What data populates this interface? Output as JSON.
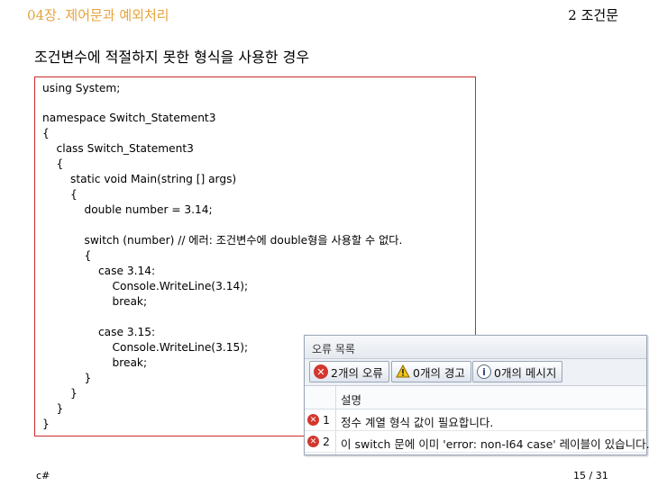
{
  "header": {
    "chapter_title": "04장. 제어문과 예외처리",
    "section_label": "2 조건문"
  },
  "slide_heading": "조건변수에 적절하지 못한 형식을 사용한 경우",
  "code": {
    "lines": [
      "using System;",
      "",
      "namespace Switch_Statement3",
      "{",
      "    class Switch_Statement3",
      "    {",
      "        static void Main(string [] args)",
      "        {",
      "            double number = 3.14;",
      "",
      "            switch (number) // 에러: 조건변수에 double형을 사용할 수 없다.",
      "            {",
      "                case 3.14:",
      "                    Console.WriteLine(3.14);",
      "                    break;",
      "",
      "                case 3.15:",
      "                    Console.WriteLine(3.15);",
      "                    break;",
      "            }",
      "        }",
      "    }",
      "}"
    ]
  },
  "error_list": {
    "title": "오류 목록",
    "filters": {
      "errors": "2개의 오류",
      "warnings": "0개의 경고",
      "messages": "0개의 메시지"
    },
    "columns": {
      "description": "설명"
    },
    "rows": [
      {
        "num": "1",
        "description": "정수 계열 형식 값이 필요합니다."
      },
      {
        "num": "2",
        "description": "이 switch 문에 이미 'error: non-I64 case' 레이블이 있습니다."
      }
    ]
  },
  "footer": {
    "left": "c#",
    "page": "15 / 31"
  },
  "colors": {
    "chapter_title": "#e8a33a",
    "code_border": "#cc2a2a",
    "error_icon": "#d2382f",
    "warning_icon": "#f0c419"
  }
}
